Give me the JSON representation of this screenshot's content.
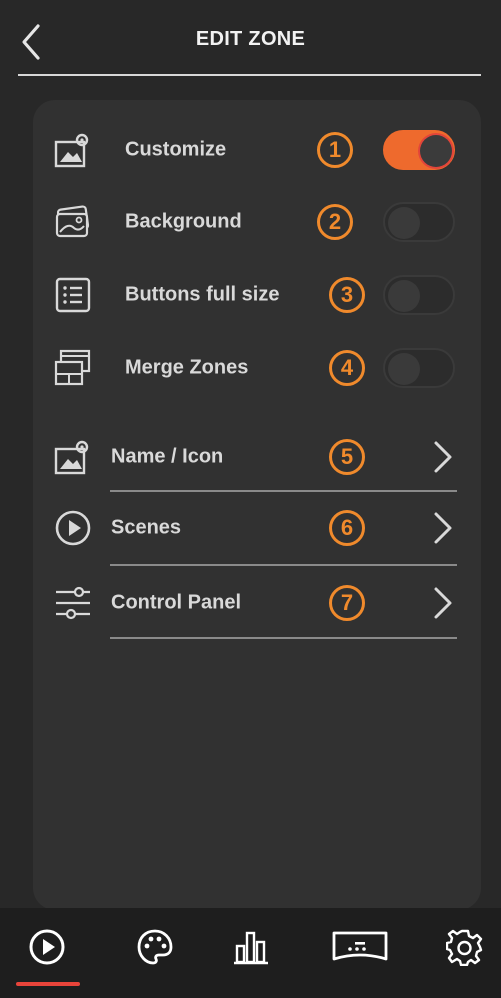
{
  "header": {
    "title": "EDIT ZONE",
    "back_icon": "chevron-left-icon"
  },
  "toggles": [
    {
      "label": "Customize",
      "badge": "1",
      "icon": "image-settings-icon",
      "on": true
    },
    {
      "label": "Background",
      "badge": "2",
      "icon": "images-stack-icon",
      "on": false
    },
    {
      "label": "Buttons full size",
      "badge": "3",
      "icon": "list-icon",
      "on": false
    },
    {
      "label": "Merge Zones",
      "badge": "4",
      "icon": "merge-windows-icon",
      "on": false
    }
  ],
  "links": [
    {
      "label": "Name / Icon",
      "badge": "5",
      "icon": "image-settings-icon"
    },
    {
      "label": "Scenes",
      "badge": "6",
      "icon": "play-circle-icon"
    },
    {
      "label": "Control Panel",
      "badge": "7",
      "icon": "sliders-icon"
    }
  ],
  "bottom_nav": [
    {
      "name": "play-circle-icon",
      "active": true
    },
    {
      "name": "palette-icon",
      "active": false
    },
    {
      "name": "bar-chart-icon",
      "active": false
    },
    {
      "name": "display-icon",
      "active": false
    },
    {
      "name": "gear-icon",
      "active": false
    }
  ],
  "colors": {
    "accent": "#f08a2c",
    "toggle_on": "#ee6a2d",
    "active_underline": "#e8443a",
    "background": "#282828",
    "card": "#313131"
  }
}
